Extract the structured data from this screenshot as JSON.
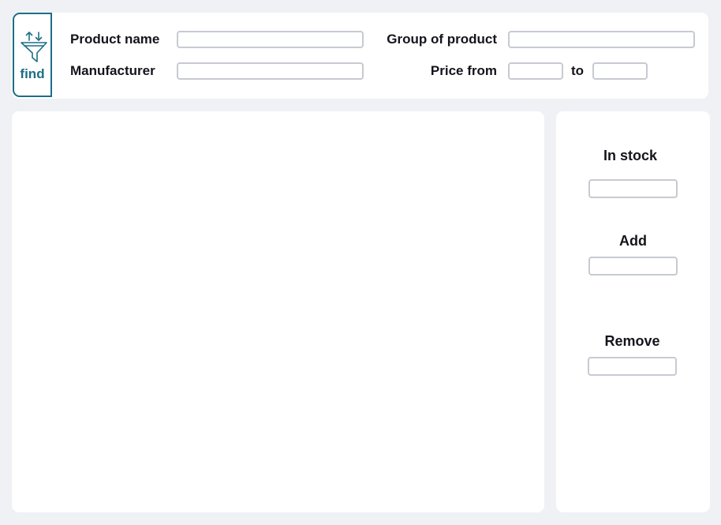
{
  "filter": {
    "find_label": "find",
    "product_name_label": "Product name",
    "product_name_value": "",
    "manufacturer_label": "Manufacturer",
    "manufacturer_value": "",
    "group_label": "Group of product",
    "group_value": "",
    "price_from_label": "Price from",
    "price_from_value": "",
    "price_to_label": "to",
    "price_to_value": ""
  },
  "stock": {
    "in_stock_label": "In stock",
    "in_stock_value": "",
    "add_label": "Add",
    "add_value": "",
    "remove_label": "Remove",
    "remove_value": ""
  },
  "colors": {
    "accent": "#1d6e87",
    "background": "#f0f1f5",
    "panel": "#ffffff",
    "field_border": "#c7cad1"
  }
}
